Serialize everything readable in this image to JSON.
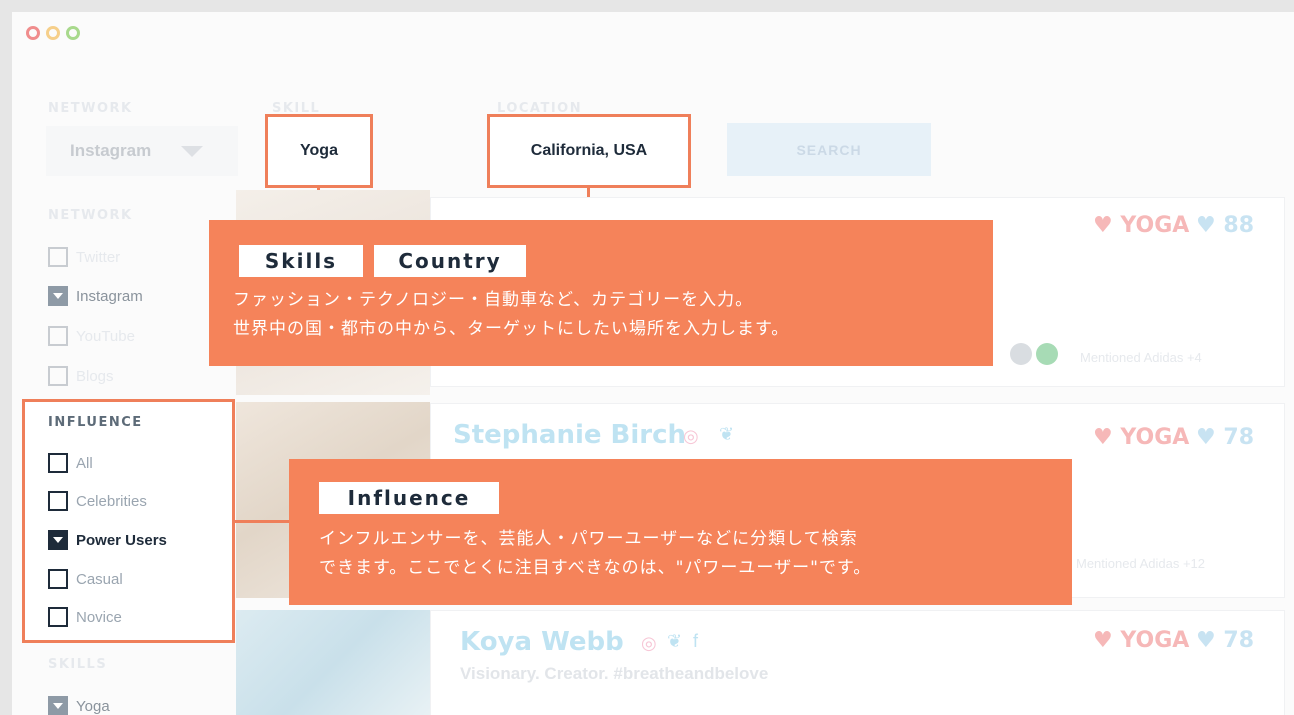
{
  "window": {
    "dot_colors": [
      "#f08d8d",
      "#f6cf8a",
      "#a8d98c"
    ]
  },
  "filters": {
    "network_label": "NETWORK",
    "network_value": "Instagram",
    "skill_label": "SKILL",
    "skill_value": "Yoga",
    "location_label": "LOCATION",
    "location_value": "California, USA",
    "search_label": "SEARCH"
  },
  "sidebar": {
    "network_heading": "NETWORK",
    "network_items": [
      {
        "label": "Twitter",
        "checked": false
      },
      {
        "label": "Instagram",
        "checked": true
      },
      {
        "label": "YouTube",
        "checked": false
      },
      {
        "label": "Blogs",
        "checked": false
      }
    ],
    "influence_heading": "INFLUENCE",
    "influence_items": [
      {
        "label": "All",
        "checked": false
      },
      {
        "label": "Celebrities",
        "checked": false
      },
      {
        "label": "Power Users",
        "checked": true
      },
      {
        "label": "Casual",
        "checked": false
      },
      {
        "label": "Novice",
        "checked": false
      }
    ],
    "skills_heading": "SKILLS",
    "skills_items": [
      {
        "label": "Yoga",
        "checked": true
      }
    ]
  },
  "results": [
    {
      "tag": "YOGA",
      "score": "88",
      "mention": "Mentioned Adidas +4"
    },
    {
      "name": "Stephanie Birch",
      "tag": "YOGA",
      "score": "78",
      "mention": "Mentioned Adidas +12"
    },
    {
      "name": "Koya Webb",
      "bio": "Visionary. Creator. #breatheandbelove",
      "tag": "YOGA",
      "score": "78"
    }
  ],
  "callouts": {
    "top": {
      "chip1": "Skills",
      "chip2": "Country",
      "line1": "ファッション・テクノロジー・自動車など、カテゴリーを入力。",
      "line2": "世界中の国・都市の中から、ターゲットにしたい場所を入力します。"
    },
    "bottom": {
      "chip1": "Influence",
      "line1": "インフルエンサーを、芸能人・パワーユーザーなどに分類して検索",
      "line2": "できます。ここでとくに注目すべきなのは、\"パワーユーザー\"です。"
    }
  },
  "colors": {
    "accent_orange": "#f5835a",
    "highlight_border": "#ef7f5a",
    "dark_text": "#1e2b3a"
  }
}
